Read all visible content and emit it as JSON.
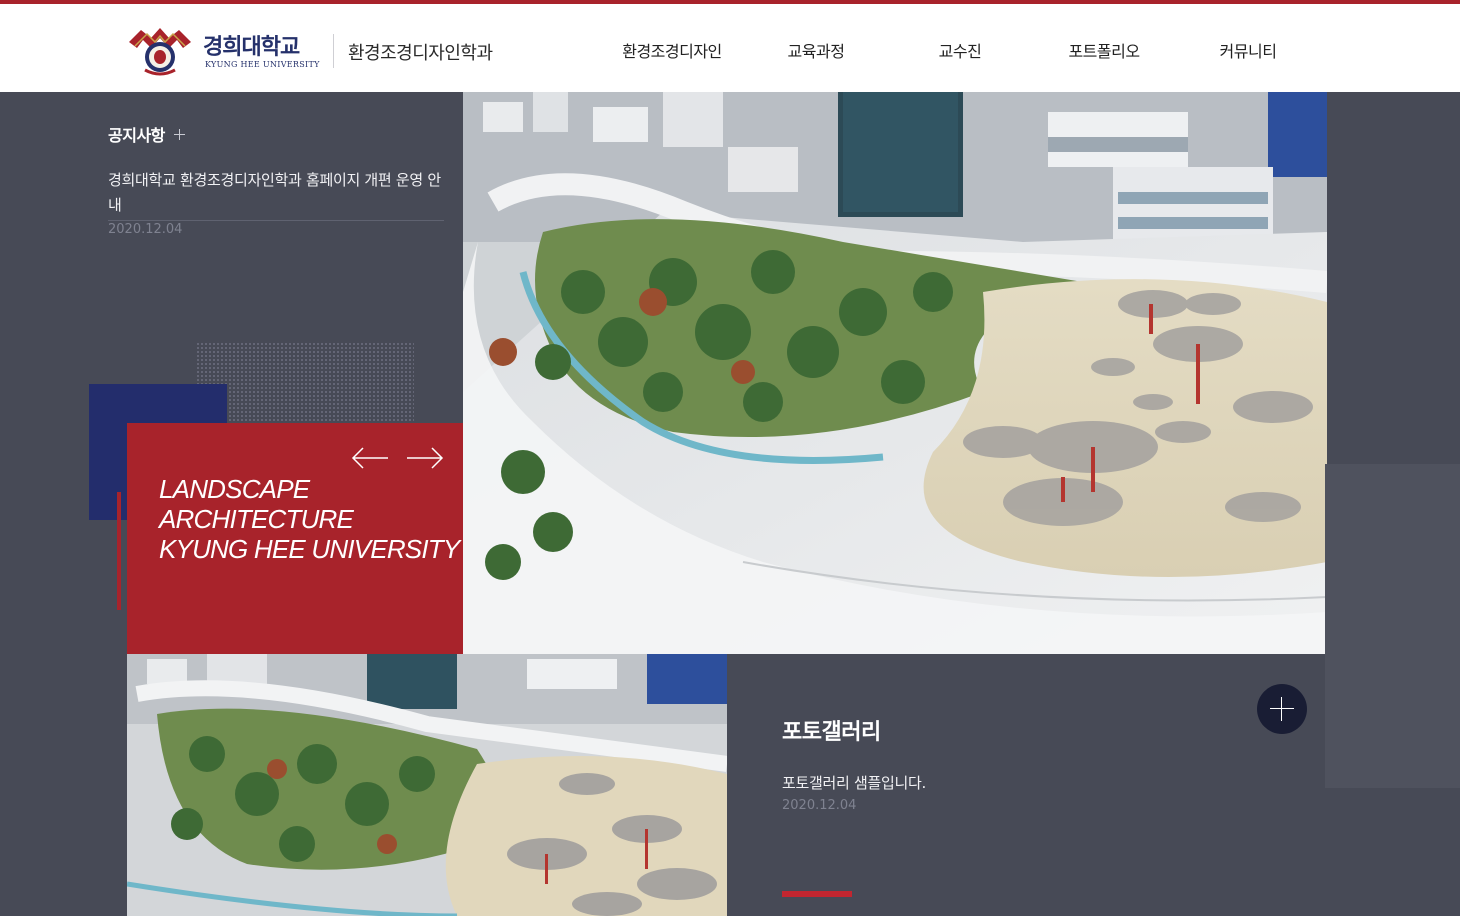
{
  "header": {
    "logo": {
      "name_ko": "경희대학교",
      "name_en": "KYUNG HEE UNIVERSITY",
      "icon": "kyunghee-emblem-icon"
    },
    "department": "환경조경디자인학과",
    "nav": [
      {
        "label": "환경조경디자인"
      },
      {
        "label": "교육과정"
      },
      {
        "label": "교수진"
      },
      {
        "label": "포트폴리오"
      },
      {
        "label": "커뮤니티"
      }
    ]
  },
  "notice": {
    "title": "공지사항",
    "more_icon": "plus-icon",
    "items": [
      {
        "title": "경희대학교 환경조경디자인학과 홈페이지 개편 운영 안내",
        "date": "2020.12.04"
      }
    ]
  },
  "hero": {
    "slogan": [
      "LANDSCAPE",
      "ARCHITECTURE",
      "KYUNG HEE UNIVERSITY"
    ],
    "prev_icon": "arrow-left-icon",
    "next_icon": "arrow-right-icon"
  },
  "gallery": {
    "title": "포토갤러리",
    "items": [
      {
        "caption": "포토갤러리 샘플입니다.",
        "date": "2020.12.04"
      }
    ],
    "more_icon": "plus-icon"
  },
  "colors": {
    "brand_red": "#a8232b",
    "brand_navy": "#232d6c",
    "background": "#474a56",
    "header_bg": "#ffffff"
  }
}
